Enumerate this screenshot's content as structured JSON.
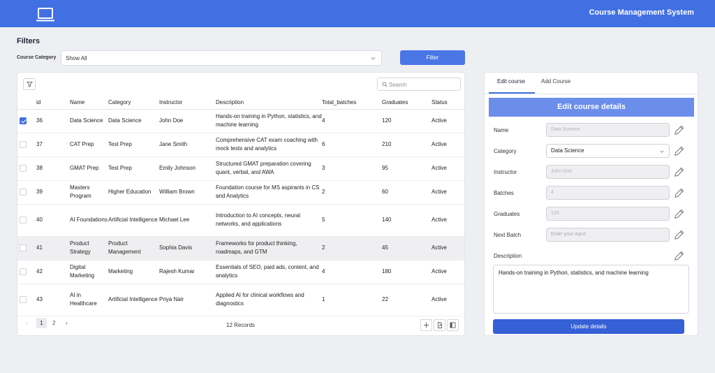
{
  "header": {
    "title": "Course Management System",
    "logo_icon": "laptop-icon"
  },
  "filters": {
    "title": "Filters",
    "category_label": "Course Category",
    "category_value": "Show All",
    "filter_button": "Filter"
  },
  "table": {
    "search_placeholder": "Search",
    "columns": [
      "id",
      "Name",
      "Category",
      "Instructor",
      "Description",
      "Total_batches",
      "Graduates",
      "Status"
    ],
    "rows": [
      {
        "selected": true,
        "id": "36",
        "name": "Data Science",
        "category": "Data Science",
        "instructor": "John Doe",
        "description": "Hands-on training in Python, statistics, and machine learning",
        "total_batches": "4",
        "graduates": "120",
        "status": "Active"
      },
      {
        "selected": false,
        "id": "37",
        "name": "CAT Prep",
        "category": "Test Prep",
        "instructor": "Jane Smith",
        "description": "Comprehensive CAT exam coaching with mock tests and analytics",
        "total_batches": "6",
        "graduates": "210",
        "status": "Active"
      },
      {
        "selected": false,
        "id": "38",
        "name": "GMAT Prep",
        "category": "Test Prep",
        "instructor": "Emily Johnson",
        "description": "Structured GMAT preparation covering quant, verbal, and AWA",
        "total_batches": "3",
        "graduates": "95",
        "status": "Active"
      },
      {
        "selected": false,
        "id": "39",
        "name": "Masters Program",
        "category": "Higher Education",
        "instructor": "William Brown",
        "description": "Foundation course for MS aspirants in CS and Analytics",
        "total_batches": "2",
        "graduates": "60",
        "status": "Active"
      },
      {
        "selected": false,
        "id": "40",
        "name": "AI Foundations",
        "category": "Artificial Intelligence",
        "instructor": "Michael Lee",
        "description": "Introduction to AI concepts, neural networks, and applications",
        "total_batches": "5",
        "graduates": "140",
        "status": "Active"
      },
      {
        "selected": false,
        "id": "41",
        "name": "Product Strategy",
        "category": "Product Management",
        "instructor": "Sophia Davis",
        "description": "Frameworks for product thinking, roadmaps, and GTM",
        "total_batches": "2",
        "graduates": "45",
        "status": "Active"
      },
      {
        "selected": false,
        "id": "42",
        "name": "Digital Marketing",
        "category": "Marketing",
        "instructor": "Rajesh Kumar",
        "description": "Essentials of SEO, paid ads, content, and analytics",
        "total_batches": "4",
        "graduates": "180",
        "status": "Active"
      },
      {
        "selected": false,
        "id": "43",
        "name": "AI in Healthcare",
        "category": "Artificial Intelligence",
        "instructor": "Priya Nair",
        "description": "Applied AI for clinical workflows and diagnostics",
        "total_batches": "1",
        "graduates": "22",
        "status": "Active"
      }
    ],
    "pagination": {
      "prev": "‹",
      "pages": [
        "1",
        "2"
      ],
      "next": "›",
      "current_page": "1"
    },
    "records_label": "12 Records"
  },
  "editor": {
    "tabs": [
      "Edit course",
      "Add Course"
    ],
    "active_tab": "Edit course",
    "form_title": "Edit course details",
    "fields": {
      "name": {
        "label": "Name",
        "value": "Data Science"
      },
      "category": {
        "label": "Category",
        "value": "Data Science"
      },
      "instructor": {
        "label": "Instructor",
        "value": "John Doe"
      },
      "batches": {
        "label": "Batches",
        "value": "4"
      },
      "graduates": {
        "label": "Graduates",
        "value": "120"
      },
      "next_batch": {
        "label": "Next Batch",
        "placeholder": "Enter your input"
      },
      "description": {
        "label": "Description",
        "value": "Hands-on training in Python, statistics, and machine learning"
      }
    },
    "update_button": "Update details"
  },
  "colors": {
    "primary": "#4170e3",
    "header_band": "#6b8eea",
    "button": "#3560d6"
  }
}
